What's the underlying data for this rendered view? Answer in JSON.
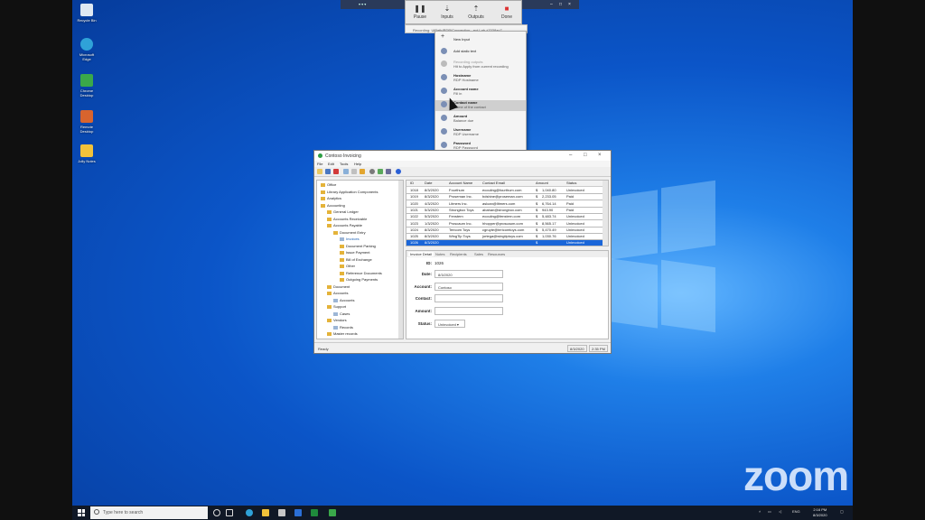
{
  "desktop_icons": [
    {
      "label": "Recycle Bin",
      "icon": "recycle-bin-icon"
    },
    {
      "label": "Microsoft Edge",
      "icon": "edge-icon"
    },
    {
      "label": "Chrome Desktop",
      "icon": "remote-app-icon"
    },
    {
      "label": "Remote Desktop",
      "icon": "users-icon"
    },
    {
      "label": "Jolly Notes",
      "icon": "notes-icon"
    }
  ],
  "remote_toolbar": {
    "pause": "Pause",
    "inputs": "Inputs",
    "outputs": "Outputs",
    "done": "Done",
    "recording_label": "Recording: UiPath/RDP/Connection - ect Lab ±7038ac7"
  },
  "context_menu": [
    {
      "title": "New Input",
      "sub": ""
    },
    {
      "title": "Add static text",
      "sub": ""
    },
    {
      "title": "Recording outputs",
      "sub": "Hit to Apply from current recording"
    },
    {
      "title": "Hostname",
      "sub": "RDP Hostname"
    },
    {
      "title": "Account name",
      "sub": "Fill in"
    },
    {
      "title": "Contact name",
      "sub": "Name of the contact"
    },
    {
      "title": "Amount",
      "sub": "Balance due"
    },
    {
      "title": "Username",
      "sub": "RDP Username"
    },
    {
      "title": "Password",
      "sub": "RDP Password"
    }
  ],
  "app": {
    "title": "Contoso Invoicing",
    "menu": [
      "File",
      "Edit",
      "Tools",
      "Help"
    ],
    "tree": [
      {
        "label": "Office",
        "indent": 0,
        "kind": "folder"
      },
      {
        "label": "Library Application Components",
        "indent": 0,
        "kind": "folder"
      },
      {
        "label": "Analytics",
        "indent": 0,
        "kind": "folder"
      },
      {
        "label": "Accounting",
        "indent": 0,
        "kind": "folder"
      },
      {
        "label": "General Ledger",
        "indent": 1,
        "kind": "folder"
      },
      {
        "label": "Accounts Receivable",
        "indent": 1,
        "kind": "folder"
      },
      {
        "label": "Accounts Payable",
        "indent": 1,
        "kind": "folder"
      },
      {
        "label": "Document Entry",
        "indent": 2,
        "kind": "folder"
      },
      {
        "label": "Invoices",
        "indent": 3,
        "kind": "page"
      },
      {
        "label": "Document Parking",
        "indent": 3,
        "kind": "folder"
      },
      {
        "label": "Issue Payment",
        "indent": 3,
        "kind": "folder"
      },
      {
        "label": "Bill of Exchange",
        "indent": 3,
        "kind": "folder"
      },
      {
        "label": "Other",
        "indent": 3,
        "kind": "folder"
      },
      {
        "label": "Reference Documents",
        "indent": 3,
        "kind": "folder"
      },
      {
        "label": "Outgoing Payments",
        "indent": 3,
        "kind": "folder"
      },
      {
        "label": "Document",
        "indent": 1,
        "kind": "folder"
      },
      {
        "label": "Accounts",
        "indent": 1,
        "kind": "folder"
      },
      {
        "label": "Accounts",
        "indent": 2,
        "kind": "page"
      },
      {
        "label": "Support",
        "indent": 1,
        "kind": "folder"
      },
      {
        "label": "Cases",
        "indent": 2,
        "kind": "page"
      },
      {
        "label": "Vendors",
        "indent": 1,
        "kind": "folder"
      },
      {
        "label": "Records",
        "indent": 2,
        "kind": "page"
      },
      {
        "label": "Master records",
        "indent": 1,
        "kind": "folder"
      }
    ],
    "grid": {
      "columns": [
        "ID",
        "Date",
        "Account Name",
        "Contact Email",
        "Amount",
        "Status"
      ],
      "rows": [
        [
          "1018",
          "8/3/2020",
          "Fourthum",
          "ecouling@fourthum.com",
          "$",
          "1,040.80",
          "Uninvoiced"
        ],
        [
          "1019",
          "8/3/2020",
          "Proseman Inc.",
          "bdshine@proseman.com",
          "$",
          "2,233.05",
          "Paid"
        ],
        [
          "1020",
          "4/3/2020",
          "Litmers Inc.",
          "asloan@litmers.com",
          "$",
          "6,764.14",
          "Paid"
        ],
        [
          "1021",
          "5/3/2020",
          "Strongbox Toys",
          "abahan@strongbox.com",
          "$",
          "943.90",
          "Paid"
        ],
        [
          "1022",
          "5/3/2020",
          "Fenstern",
          "ecouling@fenstern.com",
          "$",
          "5,483.74",
          "Uninvoiced"
        ],
        [
          "1023",
          "1/3/2020",
          "Proscaum Inc.",
          "hhopper@proscaum.com",
          "$",
          "8,565.17",
          "Uninvoiced"
        ],
        [
          "1024",
          "8/3/2020",
          "Tericom Toys",
          "cgruyte@tericomtoys.com",
          "$",
          "5,470.49",
          "Uninvoiced"
        ],
        [
          "1025",
          "8/3/2020",
          "WingTip Toys",
          "jortega@wingtiptoys.com",
          "$",
          "1,030.76",
          "Uninvoiced"
        ],
        [
          "1026",
          "8/3/2020",
          "",
          "",
          "$",
          "",
          "Uninvoiced"
        ]
      ]
    },
    "detail_tabs": [
      "Invoice Detail",
      "Notes",
      "Recipients",
      "Sales",
      "Resources"
    ],
    "fields": {
      "id_label": "ID:",
      "id_value": "1026",
      "date_label": "Date:",
      "date_value": "8/3/2020",
      "account_label": "Account:",
      "account_value": "Contoso",
      "contact_label": "Contact:",
      "contact_value": "",
      "amount_label": "Amount:",
      "amount_value": "",
      "status_label": "Status:",
      "status_value": "Uninvoiced"
    },
    "status": {
      "left": "Ready",
      "date": "8/3/2020",
      "time": "2:35 PM"
    }
  },
  "taskbar": {
    "search_placeholder": "Type here to search",
    "lang": "ENG",
    "time": "2:16 PM",
    "date": "8/3/2020"
  },
  "watermark": "zoom"
}
